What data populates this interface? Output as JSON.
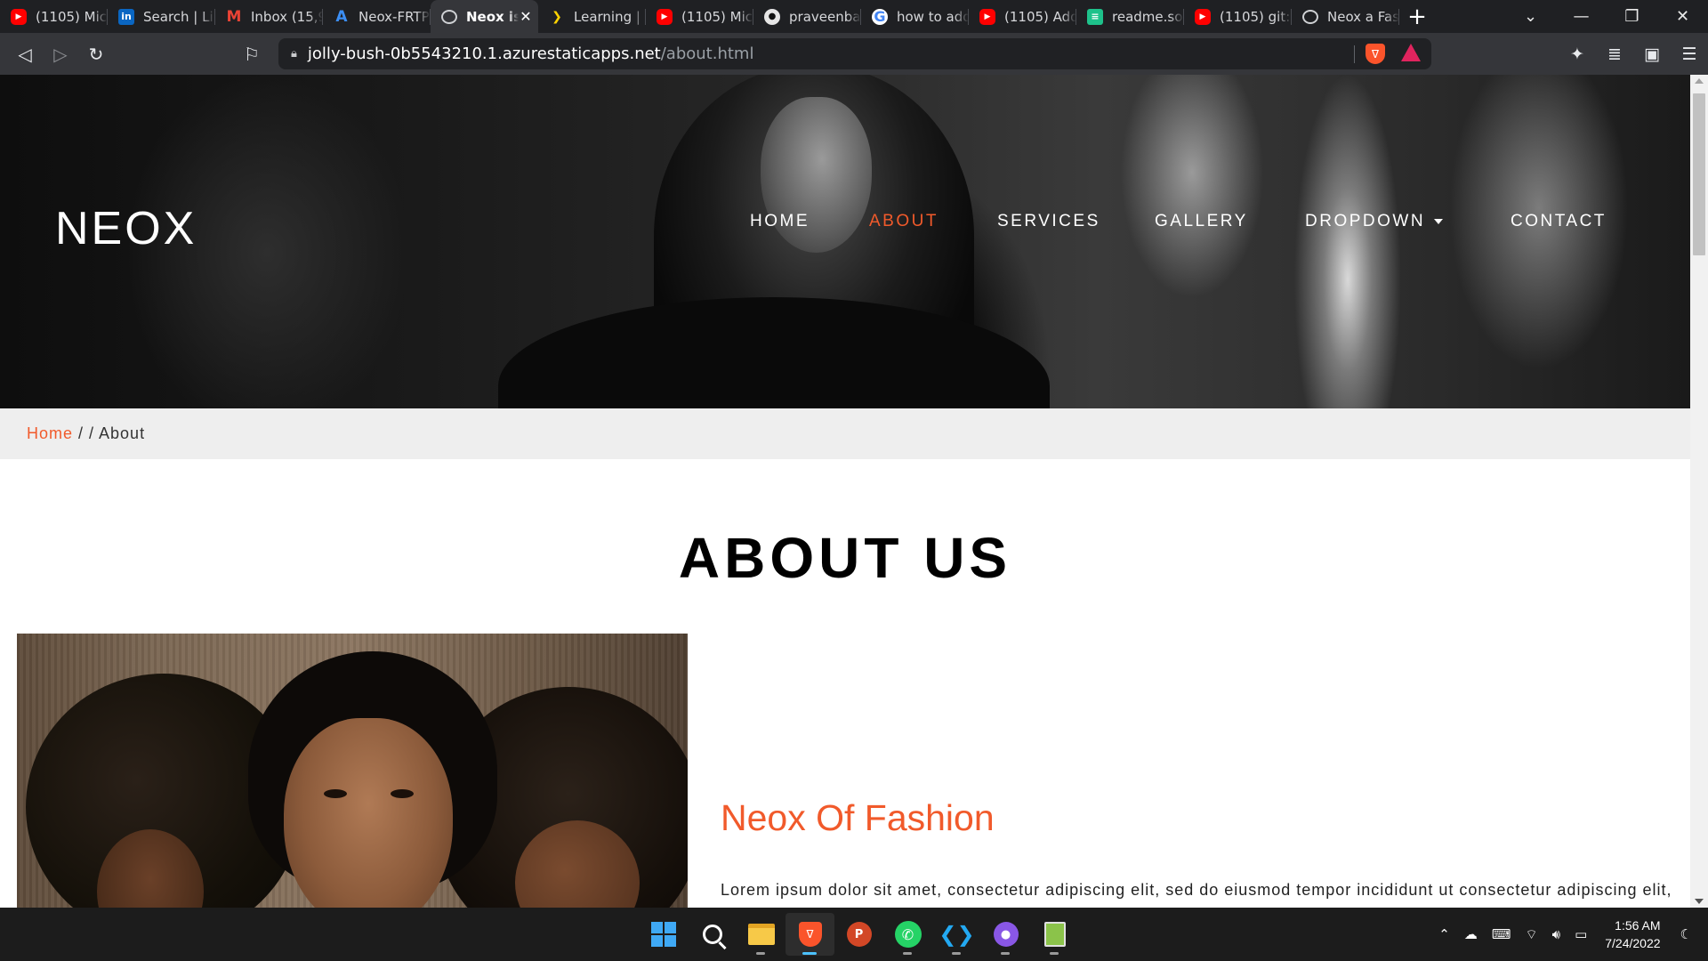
{
  "browser": {
    "tabs": [
      {
        "icon": "youtube-icon",
        "title": "(1105) Micr"
      },
      {
        "icon": "linkedin-icon",
        "title": "Search | Lin"
      },
      {
        "icon": "gmail-icon",
        "title": "Inbox (15,9"
      },
      {
        "icon": "azure-icon",
        "title": "Neox-FRTP"
      },
      {
        "icon": "globe-icon",
        "title": "Neox is"
      },
      {
        "icon": "pluralsight-icon",
        "title": "Learning | F"
      },
      {
        "icon": "youtube-icon",
        "title": "(1105) Micr"
      },
      {
        "icon": "github-icon",
        "title": "praveenbal"
      },
      {
        "icon": "google-icon",
        "title": "how to add"
      },
      {
        "icon": "youtube-icon",
        "title": "(1105) Add"
      },
      {
        "icon": "readme-icon",
        "title": "readme.so"
      },
      {
        "icon": "youtube-icon",
        "title": "(1105) git:"
      },
      {
        "icon": "globe-icon",
        "title": "Neox a Fas"
      }
    ],
    "active_tab_index": 4,
    "url_host": "jolly-bush-0b5543210.1.azurestaticapps.net",
    "url_path": "/about.html"
  },
  "site": {
    "logo": "NEOX",
    "nav": [
      "HOME",
      "ABOUT",
      "SERVICES",
      "GALLERY",
      "DROPDOWN",
      "CONTACT"
    ],
    "active_nav": "ABOUT",
    "accent_color": "#f15a2b",
    "breadcrumb": {
      "home": "Home",
      "separator": "/ / About"
    },
    "heading": "ABOUT US",
    "subheading": "Neox Of Fashion",
    "paragraph": "Lorem ipsum dolor sit amet, consectetur adipiscing elit, sed do eiusmod tempor incididunt ut consectetur adipiscing elit, sed do eiusmod tempor incididunt ut Lorem ipsum dolor sit amet, consectetur adipiscing elit, sed do eiusmod tempor incididunt ut"
  },
  "taskbar": {
    "apps": [
      "start-icon",
      "search-icon",
      "file-explorer-icon",
      "brave-icon",
      "powerpoint-icon",
      "whatsapp-icon",
      "vscode-icon",
      "github-desktop-icon",
      "notepad-icon"
    ],
    "time": "1:56 AM",
    "date": "7/24/2022"
  }
}
